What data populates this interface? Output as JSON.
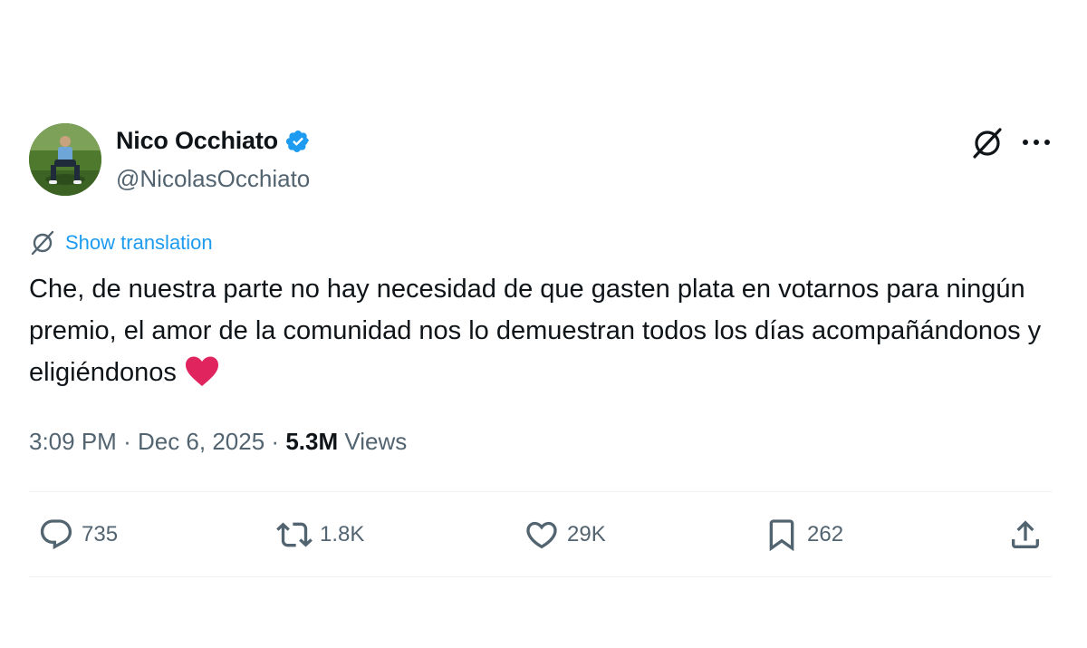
{
  "author": {
    "name": "Nico Occhiato",
    "handle": "@NicolasOcchiato",
    "verified": true,
    "verified_color": "#1d9bf0"
  },
  "header_icons": [
    "grok-icon",
    "more-icon"
  ],
  "translate": {
    "icon": "grok-icon",
    "label": "Show translation"
  },
  "tweet": {
    "text": "Che, de nuestra parte no hay necesidad de que gasten plata en votarnos para ningún premio, el amor de la comunidad nos lo demuestran todos los días acompañándonos y eligiéndonos",
    "emoji": "red-heart"
  },
  "meta": {
    "time": "3:09 PM",
    "separator": "·",
    "date": "Dec 6, 2025",
    "views_count": "5.3M",
    "views_label": "Views"
  },
  "actions": {
    "reply_count": "735",
    "retweet_count": "1.8K",
    "like_count": "29K",
    "bookmark_count": "262"
  },
  "colors": {
    "text": "#0f1419",
    "secondary": "#536471",
    "link": "#1d9bf0",
    "heart": "#e0245e"
  }
}
